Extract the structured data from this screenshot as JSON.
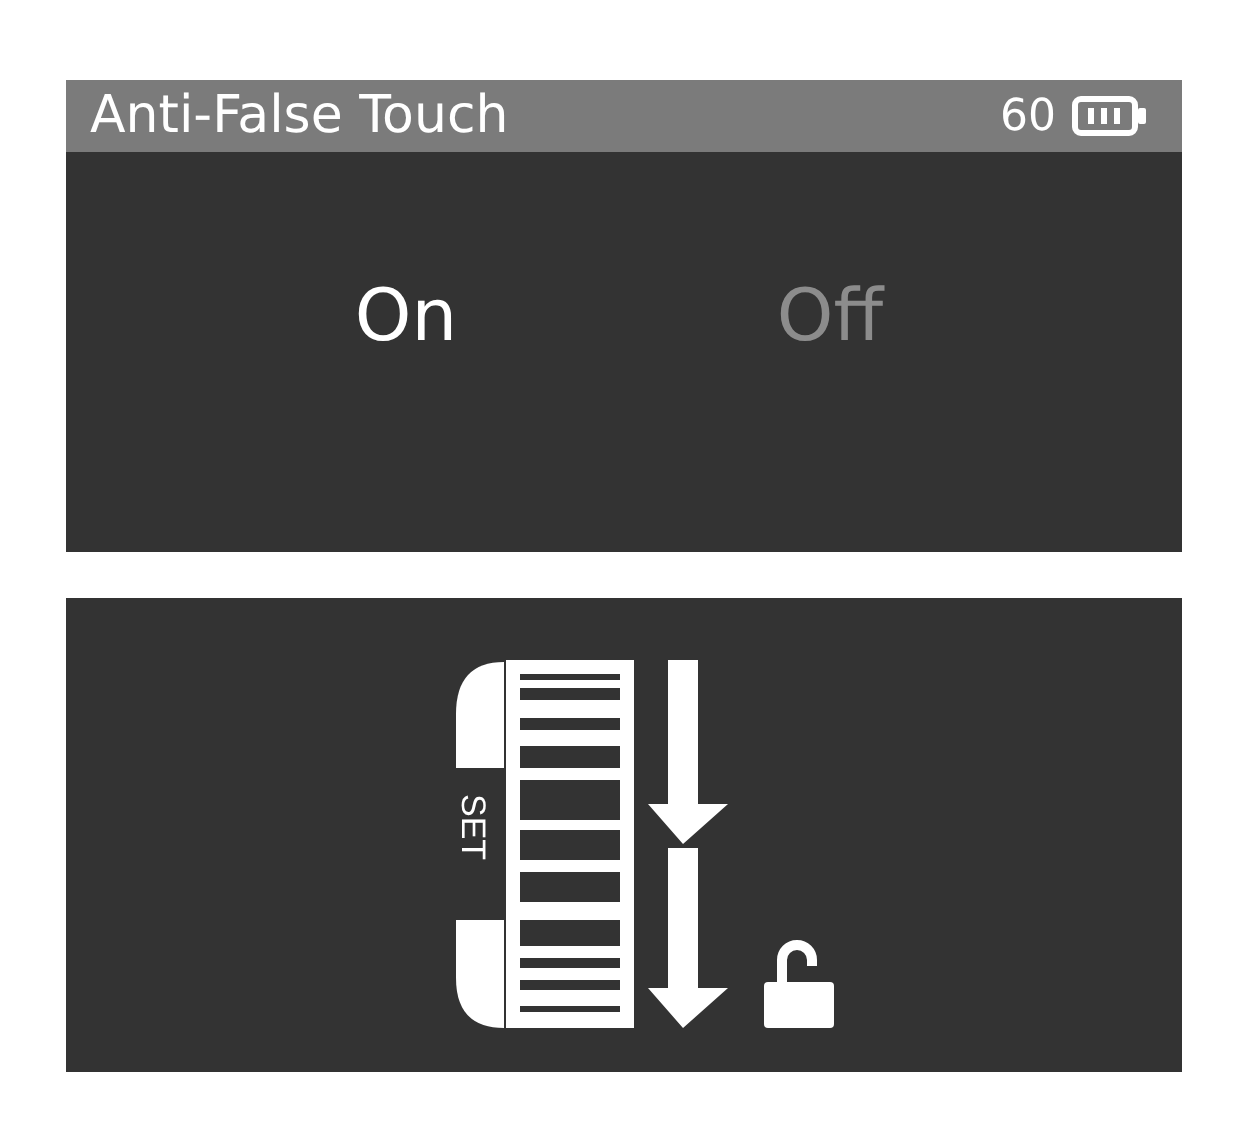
{
  "settings_panel": {
    "title": "Anti-False Touch",
    "battery_reading": "60",
    "options": [
      {
        "label": "On",
        "selected": true
      },
      {
        "label": "Off",
        "selected": false
      }
    ]
  },
  "preview_panel": {
    "wheel_label": "SET"
  }
}
